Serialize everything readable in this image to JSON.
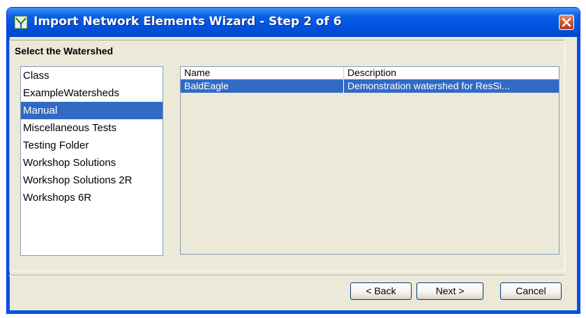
{
  "window": {
    "title": "Import Network Elements Wizard - Step 2 of 6",
    "icon": "watershed-app-icon",
    "close_icon": "close-icon"
  },
  "section": {
    "title": "Select the Watershed"
  },
  "folders": {
    "items": [
      {
        "label": "Class",
        "selected": false
      },
      {
        "label": "ExampleWatersheds",
        "selected": false
      },
      {
        "label": "Manual",
        "selected": true
      },
      {
        "label": "Miscellaneous Tests",
        "selected": false
      },
      {
        "label": "Testing Folder",
        "selected": false
      },
      {
        "label": "Workshop Solutions",
        "selected": false
      },
      {
        "label": "Workshop Solutions 2R",
        "selected": false
      },
      {
        "label": "Workshops 6R",
        "selected": false
      }
    ]
  },
  "watersheds": {
    "columns": [
      "Name",
      "Description"
    ],
    "rows": [
      {
        "name": "BaldEagle",
        "description": "Demonstration watershed for ResSi...",
        "selected": true
      }
    ]
  },
  "buttons": {
    "back": "< Back",
    "next": "Next >",
    "cancel": "Cancel"
  },
  "colors": {
    "selection": "#316ac5",
    "titlebar": "#0054e3",
    "dialog_bg": "#ece9d8"
  }
}
